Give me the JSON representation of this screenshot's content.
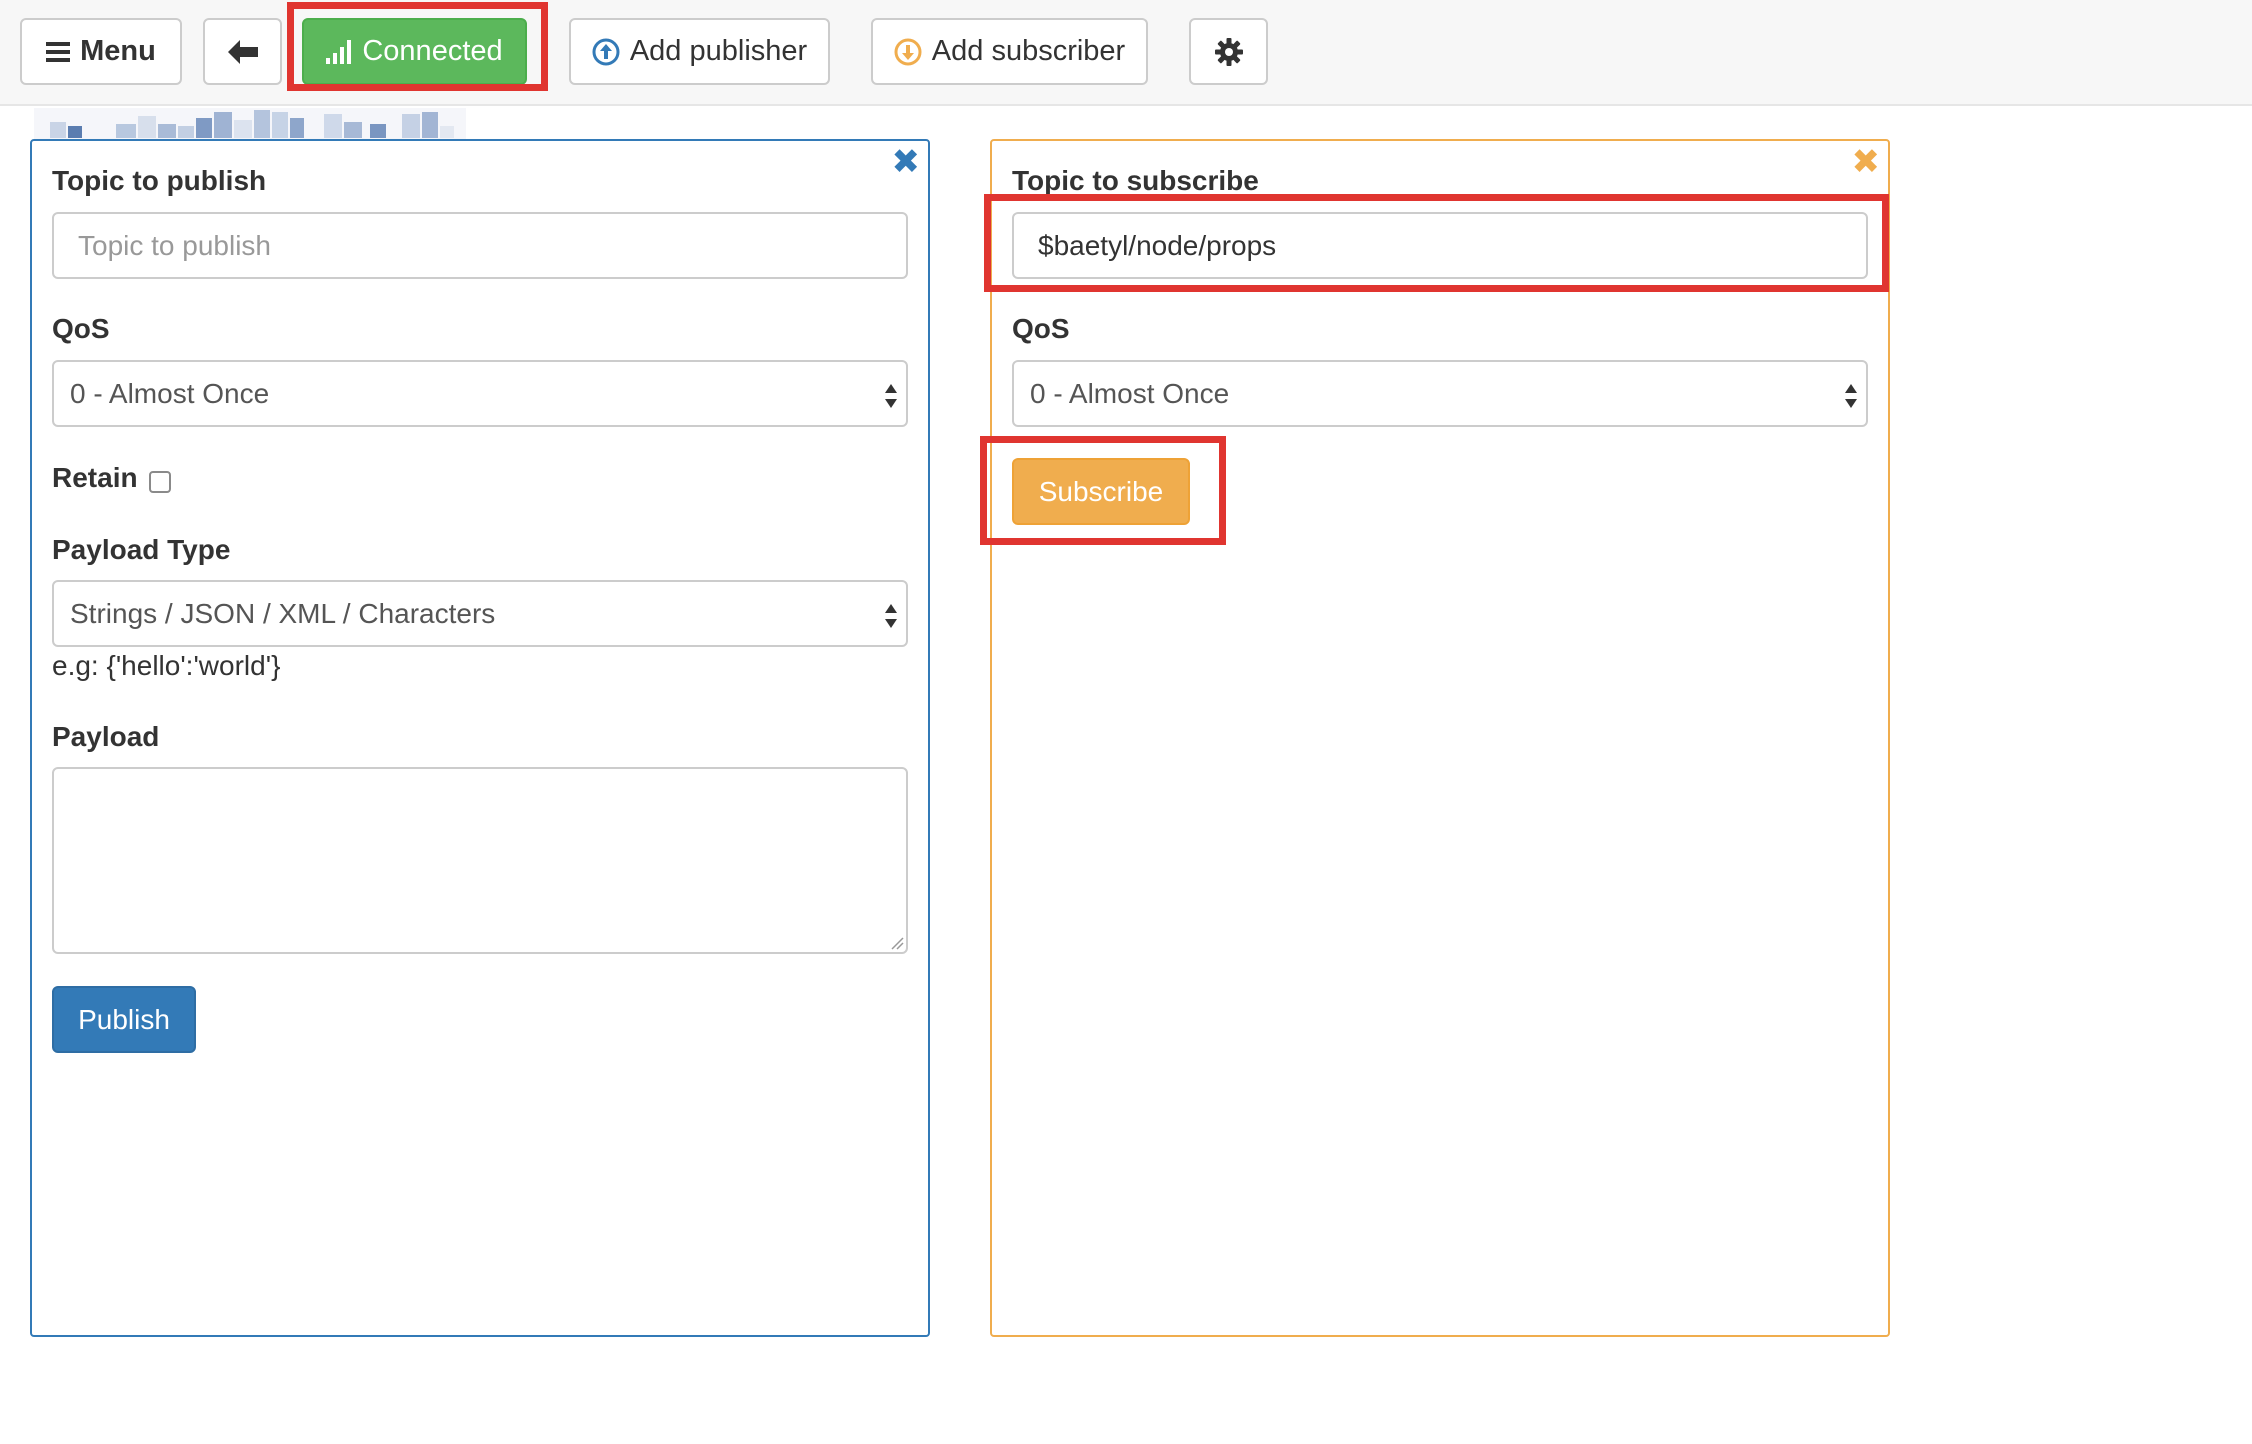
{
  "toolbar": {
    "menu_label": "Menu",
    "connected_label": "Connected",
    "add_publisher_label": "Add publisher",
    "add_subscriber_label": "Add subscriber"
  },
  "publisher": {
    "topic_label": "Topic to publish",
    "topic_placeholder": "Topic to publish",
    "qos_label": "QoS",
    "qos_value": "0 - Almost Once",
    "retain_label": "Retain",
    "retain_checked": false,
    "payload_type_label": "Payload Type",
    "payload_type_value": "Strings / JSON / XML / Characters",
    "payload_hint": "e.g: {'hello':'world'}",
    "payload_label": "Payload",
    "payload_value": "",
    "publish_label": "Publish"
  },
  "subscriber": {
    "topic_label": "Topic to subscribe",
    "topic_value": "$baetyl/node/props",
    "qos_label": "QoS",
    "qos_value": "0 - Almost Once",
    "subscribe_label": "Subscribe"
  },
  "icons": {
    "menu": "hamburger-icon",
    "back": "arrow-left-icon",
    "connected": "signal-bars-icon",
    "add_publisher": "circle-arrow-up-icon",
    "add_subscriber": "circle-arrow-down-icon",
    "settings": "gear-icon",
    "close": "close-icon"
  },
  "colors": {
    "connected_green": "#5cb85c",
    "publisher_blue": "#337ab7",
    "subscriber_orange": "#f0ad4e",
    "highlight_red": "#e03530"
  }
}
